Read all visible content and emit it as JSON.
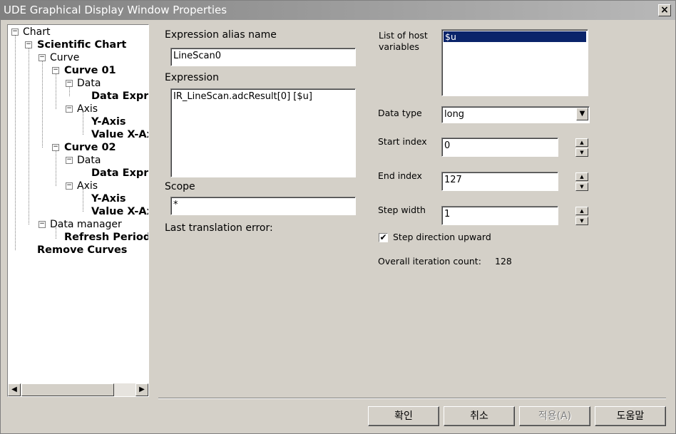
{
  "window": {
    "title": "UDE Graphical Display Window Properties",
    "close_symbol": "×"
  },
  "tree": {
    "nodes": [
      {
        "label": "Chart",
        "expander": "−"
      },
      {
        "label": "Scientific Chart",
        "expander": "−"
      },
      {
        "label": "Curve",
        "expander": "−"
      },
      {
        "label": "Curve 01",
        "expander": "−"
      },
      {
        "label": "Data",
        "expander": "−"
      },
      {
        "label": "Data Expre"
      },
      {
        "label": "Axis",
        "expander": "−"
      },
      {
        "label": "Y-Axis"
      },
      {
        "label": "Value X-Ax"
      },
      {
        "label": "Curve 02",
        "expander": "−"
      },
      {
        "label": "Data",
        "expander": "−"
      },
      {
        "label": "Data Expre"
      },
      {
        "label": "Axis",
        "expander": "−"
      },
      {
        "label": "Y-Axis"
      },
      {
        "label": "Value X-Ax"
      },
      {
        "label": "Data manager",
        "expander": "−"
      },
      {
        "label": "Refresh Period"
      },
      {
        "label": "Remove Curves"
      }
    ],
    "scroll_left": "◀",
    "scroll_right": "▶"
  },
  "form": {
    "alias_label": "Expression alias name",
    "alias_value": "LineScan0",
    "expression_label": "Expression",
    "expression_value": "IR_LineScan.adcResult[0] [$u]",
    "scope_label": "Scope",
    "scope_value": "*",
    "last_error_label": "Last translation error:"
  },
  "right": {
    "host_vars_label": "List of host variables",
    "host_vars_items": [
      "$u"
    ],
    "data_type_label": "Data type",
    "data_type_value": "long",
    "combo_arrow": "▼",
    "start_index_label": "Start index",
    "start_index_value": "0",
    "end_index_label": "End index",
    "end_index_value": "127",
    "step_width_label": "Step width",
    "step_width_value": "1",
    "spin_up": "▲",
    "spin_down": "▼",
    "step_direction_label": "Step direction upward",
    "step_direction_checked": "✔",
    "iteration_label": "Overall iteration count:",
    "iteration_value": "128"
  },
  "buttons": {
    "ok": "확인",
    "cancel": "취소",
    "apply": "적용(A)",
    "help": "도움말"
  }
}
